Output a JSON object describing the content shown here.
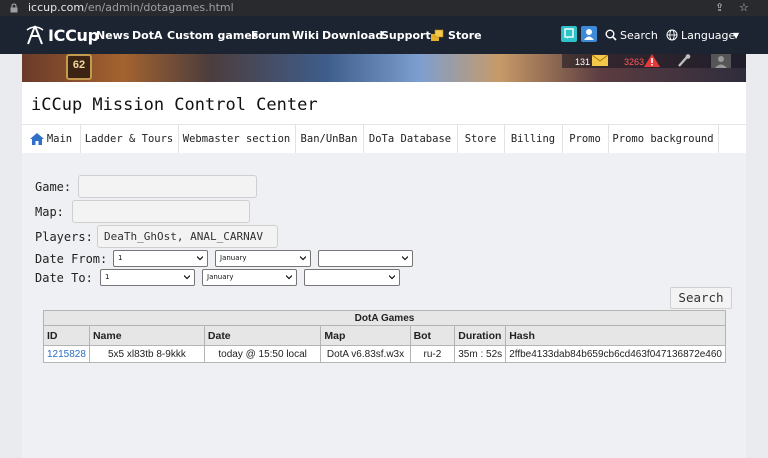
{
  "browser": {
    "url_host": "iccup.com",
    "url_path": "/en/admin/dotagames.html"
  },
  "site_nav": {
    "logo_text": "ICCup",
    "items": [
      "News",
      "DotA",
      "Custom games",
      "Forum",
      "Wiki",
      "Download",
      "Support"
    ],
    "store_label": "Store",
    "search_label": "Search",
    "language_label": "Language"
  },
  "banner": {
    "level": "62",
    "mail_count": "131",
    "alert_count": "3263"
  },
  "page": {
    "title": "iCCup Mission Control Center",
    "tabs": [
      "Main",
      "Ladder & Tours",
      "Webmaster section",
      "Ban/UnBan",
      "DoTa Database",
      "Store",
      "Billing",
      "Promo",
      "Promo background"
    ]
  },
  "form": {
    "game_label": "Game:",
    "game_value": "",
    "map_label": "Map:",
    "map_value": "",
    "players_label": "Players:",
    "players_value": "DeaTh_GhOst, ANAL_CARNAV",
    "date_from_label": "Date From:",
    "date_from_day": "1",
    "date_from_month": "January",
    "date_from_year": "",
    "date_to_label": "Date To:",
    "date_to_day": "1",
    "date_to_month": "January",
    "date_to_year": "",
    "search_button": "Search"
  },
  "table": {
    "caption": "DotA Games",
    "columns": [
      "ID",
      "Name",
      "Date",
      "Map",
      "Bot",
      "Duration",
      "Hash"
    ],
    "rows": [
      {
        "id": "1215828",
        "name": "5x5 xl83tb 8-9kkk",
        "date": "today @ 15:50 local",
        "map": "DotA v6.83sf.w3x",
        "bot": "ru-2",
        "duration": "35m : 52s",
        "hash": "2ffbe4133dab84b659cb6cd463f047136872e460"
      }
    ]
  },
  "colors": {
    "nav_bg": "#1c2331",
    "page_bg": "#e9ebee",
    "content_bg": "#eff0f3",
    "link": "#2a6ec4",
    "home_icon": "#2f6fc9"
  }
}
